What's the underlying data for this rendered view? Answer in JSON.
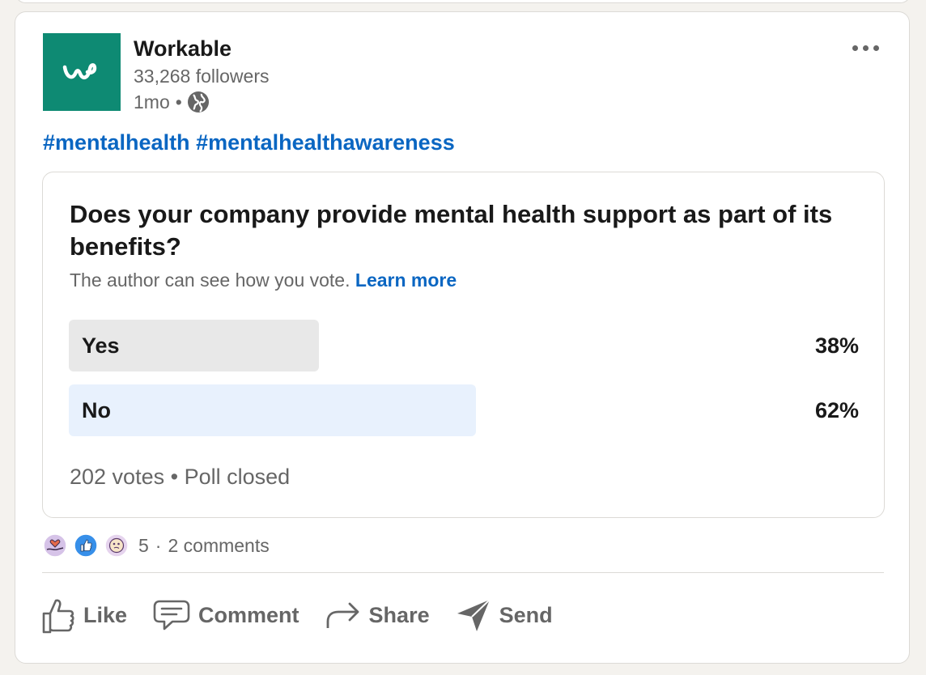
{
  "post": {
    "author": {
      "name": "Workable",
      "followers": "33,268 followers",
      "time": "1mo",
      "separator": "•"
    },
    "hashtags": [
      "#mentalhealth",
      "#mentalhealthawareness"
    ],
    "poll": {
      "question": "Does your company provide mental health support as part of its benefits?",
      "note": "The author can see how you vote.",
      "learn_more": "Learn more",
      "options": [
        {
          "label": "Yes",
          "percent": "38%",
          "fraction": 0.38,
          "color": "#e8e8e8"
        },
        {
          "label": "No",
          "percent": "62%",
          "fraction": 0.62,
          "color": "#e8f1fd"
        }
      ],
      "votes": "202 votes",
      "status": "Poll closed",
      "separator": "•"
    },
    "social": {
      "reactions": [
        "support-icon",
        "like-icon",
        "curious-icon"
      ],
      "reaction_count": "5",
      "separator": "·",
      "comments": "2 comments"
    },
    "actions": {
      "like": "Like",
      "comment": "Comment",
      "share": "Share",
      "send": "Send"
    }
  },
  "colors": {
    "brand_logo": "#0e8a73",
    "link": "#0a66c2",
    "muted_text": "#666666"
  }
}
